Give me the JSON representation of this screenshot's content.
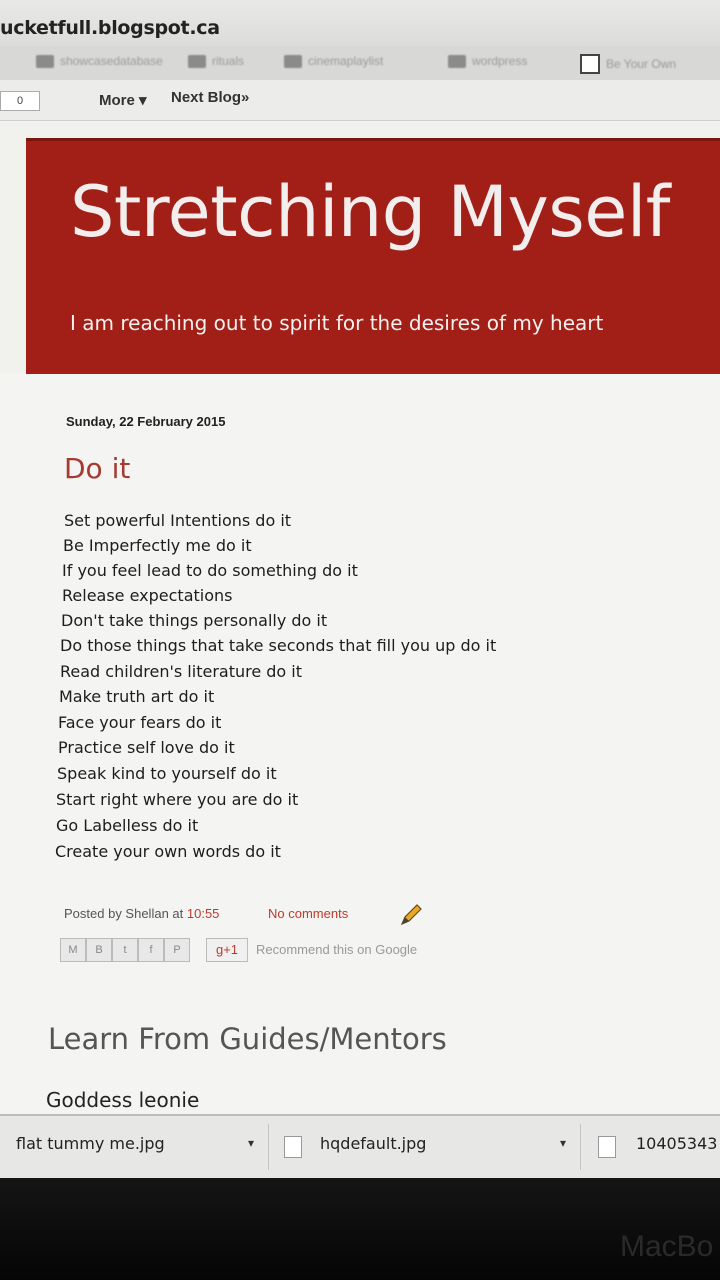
{
  "browser": {
    "url": "ucketfull.blogspot.ca",
    "bookmarks": [
      "showcasedatabase",
      "rituals",
      "cinemaplaylist",
      "wordpress",
      "Be Your Own"
    ]
  },
  "blogger_bar": {
    "button": "0",
    "more": "More",
    "next_blog": "Next Blog»"
  },
  "header": {
    "title": "Stretching Myself",
    "description": "I am reaching out to spirit for the desires of my heart"
  },
  "post": {
    "date": "Sunday, 22 February 2015",
    "title": "Do it",
    "lines": [
      "Set powerful Intentions do it",
      "Be Imperfectly me do it",
      "If you feel lead to do something do it",
      "Release expectations",
      "Don't take things personally do it",
      "Do those things that take seconds that fill you up do it",
      "Read children's literature do it",
      "Make truth art do it",
      "Face your fears do it",
      "Practice self love do it",
      "Speak kind to yourself do it",
      "Start right where you are do it",
      "Go Labelless do it",
      "Create your own words do it"
    ],
    "posted_by": "Posted by Shellan at",
    "time": "10:55",
    "comments": "No comments",
    "gplus": "g+1",
    "recommend": "Recommend this on Google"
  },
  "widget": {
    "title": "Learn From Guides/Mentors",
    "item": "Goddess leonie"
  },
  "downloads": [
    "flat tummy me.jpg",
    "hqdefault.jpg",
    "10405343"
  ],
  "device": {
    "brand": "MacBo"
  },
  "colors": {
    "header_bg": "#a11f17",
    "title_text": "#a63a30",
    "link": "#c0392b"
  }
}
